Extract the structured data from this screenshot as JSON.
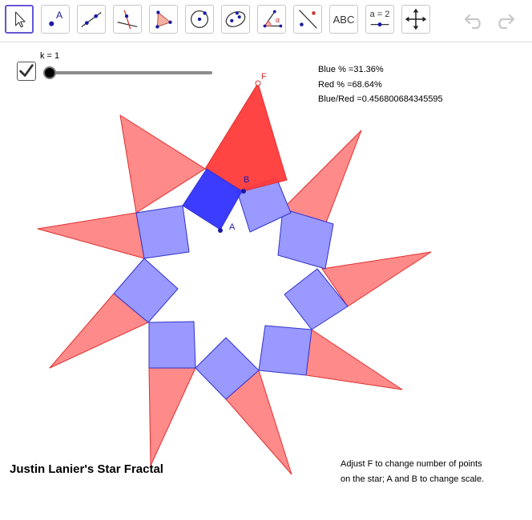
{
  "toolbar": {
    "tools": [
      {
        "name": "move-tool",
        "icon": "arrow-cursor-icon",
        "selected": true
      },
      {
        "name": "point-tool",
        "icon": "point-icon",
        "label": "A"
      },
      {
        "name": "line-tool",
        "icon": "line-icon"
      },
      {
        "name": "perpendicular-line-tool",
        "icon": "perpendicular-icon"
      },
      {
        "name": "polygon-tool",
        "icon": "polygon-icon"
      },
      {
        "name": "circle-tool",
        "icon": "circle-icon"
      },
      {
        "name": "conic-tool",
        "icon": "ellipse-icon"
      },
      {
        "name": "angle-tool",
        "icon": "angle-icon",
        "label": "α"
      },
      {
        "name": "reflect-tool",
        "icon": "reflect-icon"
      },
      {
        "name": "text-tool",
        "icon": "text-icon",
        "label": "ABC"
      },
      {
        "name": "slider-tool",
        "icon": "slider-icon",
        "label": "a = 2"
      },
      {
        "name": "move-graphics-tool",
        "icon": "move-arrows-icon"
      }
    ],
    "undo_icon": "undo-icon",
    "redo_icon": "redo-icon"
  },
  "slider": {
    "label": "k = 1",
    "value": 1,
    "checked": true
  },
  "stats": {
    "blue": "Blue % =31.36%",
    "red": "Red % =68.64%",
    "ratio": "Blue/Red =0.456800684345595"
  },
  "points": {
    "F": "F",
    "A": "A",
    "B": "B"
  },
  "title": "Justin Lanier's Star Fractal",
  "instructions": {
    "line1": "Adjust F to change number of points",
    "line2": "on the star; A and B to change scale."
  },
  "colors": {
    "triangle_fill": "#ff8a8a",
    "triangle_stroke": "#e03030",
    "square_fill": "#9999ff",
    "square_stroke": "#3333cc",
    "highlight_red": "#ff3a3a",
    "highlight_blue": "#3232ff",
    "point": "#1a1aa6",
    "point_f": "#d03030"
  }
}
